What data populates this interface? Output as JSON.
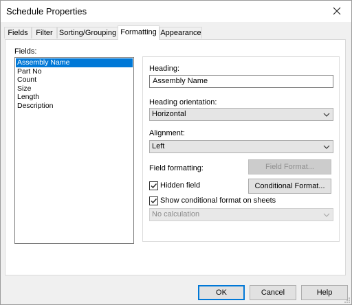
{
  "window": {
    "title": "Schedule Properties"
  },
  "tabs": [
    {
      "label": "Fields",
      "active": false
    },
    {
      "label": "Filter",
      "active": false
    },
    {
      "label": "Sorting/Grouping",
      "active": false
    },
    {
      "label": "Formatting",
      "active": true
    },
    {
      "label": "Appearance",
      "active": false
    }
  ],
  "fields": {
    "label": "Fields:",
    "items": [
      "Assembly Name",
      "Part No",
      "Count",
      "Size",
      "Length",
      "Description"
    ],
    "selected_index": 0
  },
  "heading": {
    "label": "Heading:",
    "value": "Assembly Name"
  },
  "heading_orientation": {
    "label": "Heading orientation:",
    "value": "Horizontal"
  },
  "alignment": {
    "label": "Alignment:",
    "value": "Left"
  },
  "field_formatting": {
    "label": "Field formatting:",
    "button_label": "Field Format..."
  },
  "hidden_field": {
    "label": "Hidden field",
    "checked": true
  },
  "conditional_format": {
    "button_label": "Conditional  Format..."
  },
  "show_conditional": {
    "label": "Show conditional format on sheets",
    "checked": true
  },
  "calculation": {
    "value": "No calculation"
  },
  "footer": {
    "ok_label": "OK",
    "cancel_label": "Cancel",
    "help_label": "Help"
  },
  "colors": {
    "selection": "#0078d7",
    "dialog_bg": "#f0f0f0"
  }
}
